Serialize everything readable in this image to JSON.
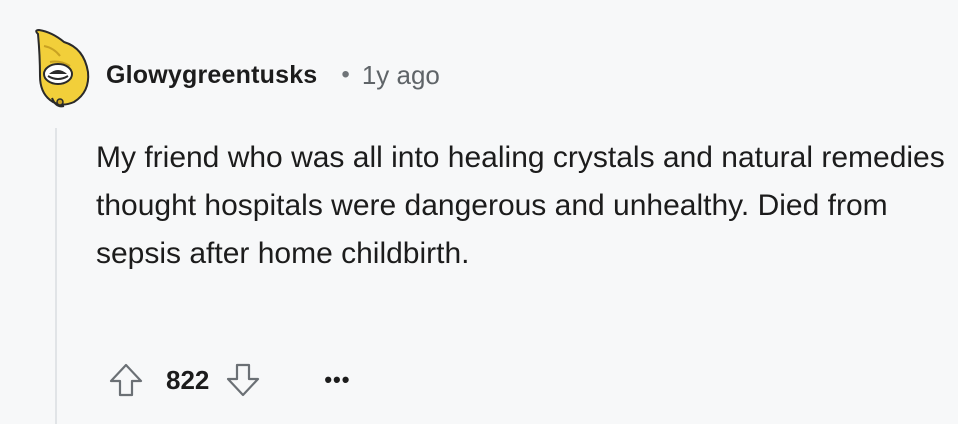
{
  "comment": {
    "username": "Glowygreentusks",
    "separator": "•",
    "timestamp": "1y ago",
    "body": "My friend who was all into healing crystals and natural remedies thought hospitals were dangerous and unhealthy. Died from sepsis after home childbirth.",
    "score": "822",
    "more_label": "•••"
  },
  "icons": {
    "avatar": "snoo-avatar-icon",
    "upvote": "arrow-up-icon",
    "downvote": "arrow-down-icon",
    "more": "overflow-menu-icon"
  },
  "colors": {
    "background": "#f7f8f9",
    "text": "#1c1c1c",
    "muted": "#5f6468",
    "thread_line": "#e1e4e7",
    "avatar_yellow": "#f2cf3a"
  }
}
